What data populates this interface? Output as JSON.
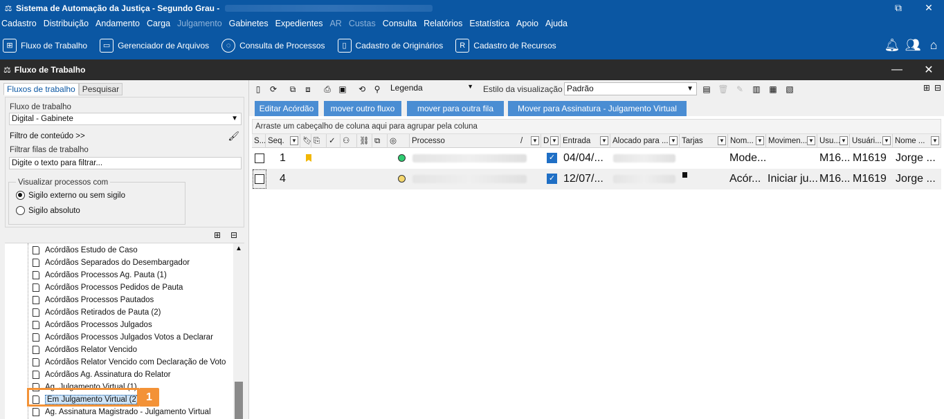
{
  "app": {
    "title": "Sistema de Automação da Justiça - Segundo Grau -",
    "title_suffix_redacted": true
  },
  "menu": [
    "Cadastro",
    "Distribuição",
    "Andamento",
    "Carga",
    "Julgamento",
    "Gabinetes",
    "Expedientes",
    "AR",
    "Custas",
    "Consulta",
    "Relatórios",
    "Estatística",
    "Apoio",
    "Ajuda"
  ],
  "menu_disabled": [
    "Julgamento",
    "AR",
    "Custas"
  ],
  "toolbar": [
    {
      "label": "Fluxo de Trabalho",
      "icon": "workflow-icon"
    },
    {
      "label": "Gerenciador de Arquivos",
      "icon": "file-manager-icon"
    },
    {
      "label": "Consulta de Processos",
      "icon": "search-process-icon"
    },
    {
      "label": "Cadastro de Originários",
      "icon": "originals-icon"
    },
    {
      "label": "Cadastro de Recursos",
      "icon": "appeals-icon"
    }
  ],
  "window": {
    "title": "Fluxo de Trabalho"
  },
  "left": {
    "tabs": [
      "Fluxos de trabalho",
      "Pesquisar"
    ],
    "flow_label": "Fluxo de trabalho",
    "flow_value": "Digital - Gabinete",
    "content_filter": "Filtro de conteúdo >>",
    "queue_filter_label": "Filtrar filas de trabalho",
    "queue_filter_placeholder": "Digite o texto para filtrar...",
    "view_group_label": "Visualizar processos com",
    "radio_external": "Sigilo externo ou sem sigilo",
    "radio_absolute": "Sigilo absoluto",
    "tree": [
      "Acórdãos Estudo de Caso",
      "Acórdãos Separados do Desembargador",
      "Acórdãos Processos Ag. Pauta (1)",
      "Acórdãos Processos Pedidos de Pauta",
      "Acórdãos Processos Pautados",
      "Acórdãos Retirados de Pauta (2)",
      "Acórdãos Processos Julgados",
      "Acórdãos Processos Julgados Votos a Declarar",
      "Acórdãos Relator Vencido",
      "Acórdãos Relator Vencido com Declaração de Voto",
      "Acórdãos Ag. Assinatura do Relator",
      "Ag. Julgamento Virtual (1)",
      "Em Julgamento Virtual (2)",
      "Ag. Assinatura Magistrado - Julgamento Virtual"
    ],
    "selected_index": 12,
    "callout_number": "1"
  },
  "right": {
    "legend": "Legenda",
    "view_style_label": "Estilo da visualização",
    "view_style_value": "Padrão",
    "actions": [
      "Editar Acórdão",
      "mover outro fluxo",
      "mover para outra fila",
      "Mover para Assinatura - Julgamento Virtual"
    ],
    "group_hint": "Arraste um cabeçalho de coluna aqui para agrupar pela coluna",
    "columns": [
      "S...",
      "Seq.",
      "Processo",
      "D",
      "Entrada",
      "Alocado para ...",
      "Tarjas",
      "Nom...",
      "Movimen...",
      "Usu...",
      "Usuári...",
      "Nome ..."
    ],
    "rows": [
      {
        "seq": "1",
        "status_color": "#2ecc71",
        "flag": true,
        "entrada": "04/04/...",
        "nome": "Mode...",
        "movimento": "",
        "usu": "M16...",
        "usuario": "M1619",
        "nome2": "Jorge ...",
        "tarja": false
      },
      {
        "seq": "4",
        "status_color": "#f5d76e",
        "flag": false,
        "entrada": "12/07/...",
        "nome": "Acór...",
        "movimento": "Iniciar ju...",
        "usu": "M16...",
        "usuario": "M1619",
        "nome2": "Jorge ...",
        "tarja": true
      }
    ]
  },
  "colors": {
    "brand": "#0b57a3",
    "button": "#4a8dd3",
    "callout": "#f39237"
  }
}
